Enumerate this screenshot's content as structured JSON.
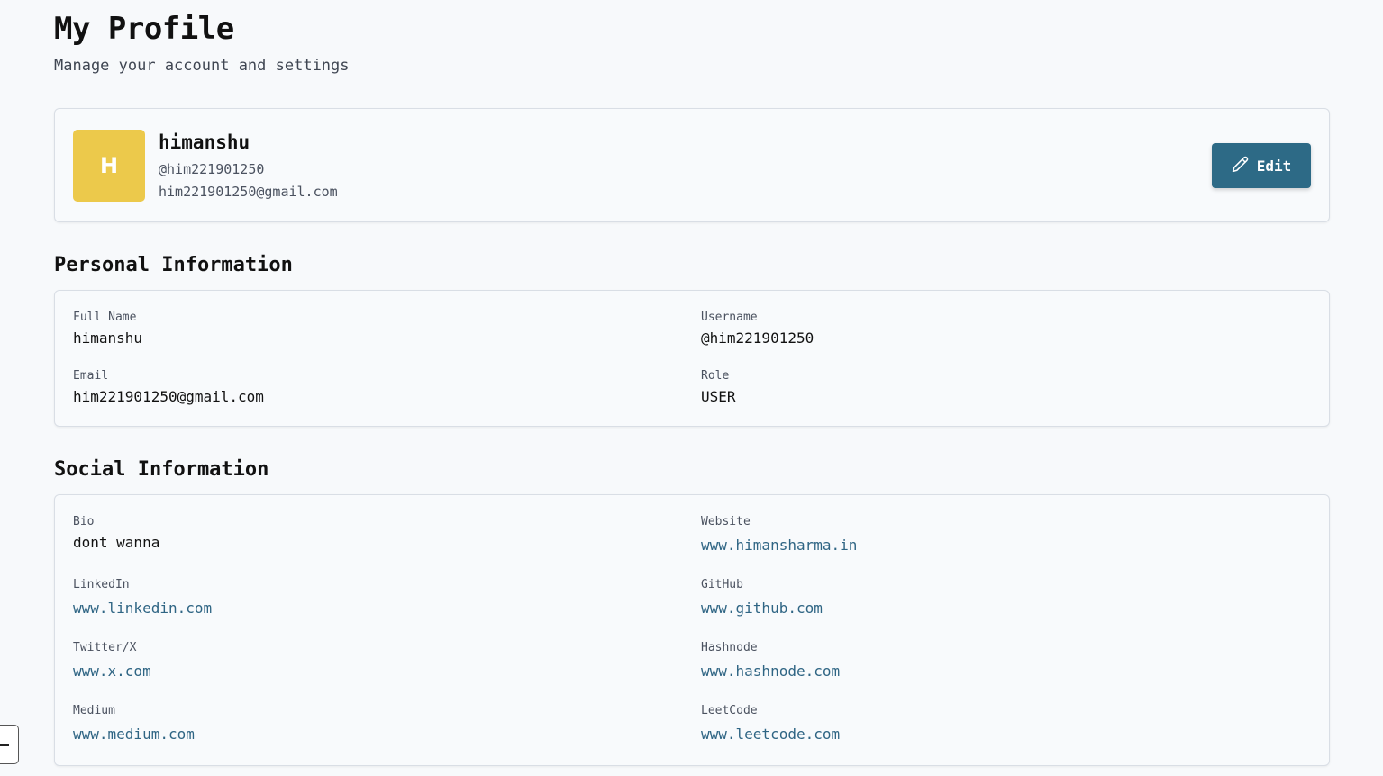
{
  "header": {
    "title": "My Profile",
    "subtitle": "Manage your account and settings"
  },
  "profile": {
    "avatar_initial": "H",
    "avatar_color": "#ecc94b",
    "name": "himanshu",
    "handle": "@him221901250",
    "email": "him221901250@gmail.com",
    "edit_label": "Edit",
    "edit_icon": "pencil-icon"
  },
  "personal": {
    "title": "Personal Information",
    "fields": [
      {
        "label": "Full Name",
        "value": "himanshu"
      },
      {
        "label": "Username",
        "value": "@him221901250"
      },
      {
        "label": "Email",
        "value": "him221901250@gmail.com"
      },
      {
        "label": "Role",
        "value": "USER"
      }
    ]
  },
  "social": {
    "title": "Social Information",
    "fields": [
      {
        "label": "Bio",
        "value": "dont wanna"
      },
      {
        "label": "Website",
        "value": "www.himansharma.in"
      },
      {
        "label": "LinkedIn",
        "value": "www.linkedin.com"
      },
      {
        "label": "GitHub",
        "value": "www.github.com"
      },
      {
        "label": "Twitter/X",
        "value": "www.x.com"
      },
      {
        "label": "Hashnode",
        "value": "www.hashnode.com"
      },
      {
        "label": "Medium",
        "value": "www.medium.com"
      },
      {
        "label": "LeetCode",
        "value": "www.leetcode.com"
      }
    ]
  },
  "colors": {
    "accent": "#2d6a86",
    "link": "#2f6584",
    "background": "#f7f9fb"
  }
}
